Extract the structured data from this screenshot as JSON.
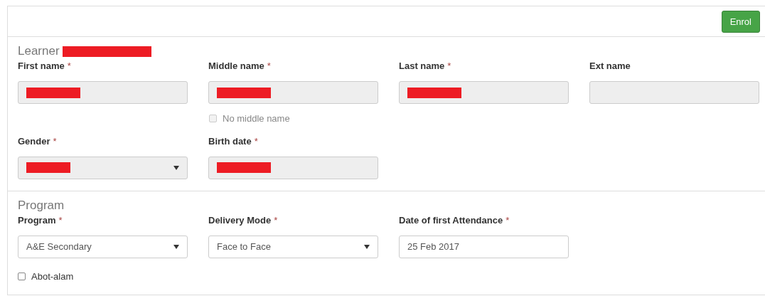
{
  "header": {
    "button": "Enrol"
  },
  "sections": [
    {
      "title": "Learner",
      "title_redacted": true,
      "rows": [
        [
          {
            "kind": "input",
            "label": "First name",
            "required_mark": "*",
            "redacted": true,
            "disabled": true
          },
          {
            "kind": "input",
            "label": "Middle name",
            "required_mark": "*",
            "redacted": true,
            "disabled": true,
            "checkbox": {
              "label": "No middle name",
              "checked": false,
              "disabled": true
            }
          },
          {
            "kind": "input",
            "label": "Last name",
            "required_mark": "*",
            "redacted": true,
            "disabled": true
          },
          {
            "kind": "input",
            "label": "Ext name",
            "disabled": true
          }
        ],
        [
          {
            "kind": "select",
            "label": "Gender",
            "required_mark": "*",
            "redacted": true,
            "disabled": true
          },
          {
            "kind": "input",
            "label": "Birth date",
            "required_mark": "*",
            "redacted": true,
            "disabled": true
          }
        ]
      ]
    },
    {
      "title": "Program",
      "rows": [
        [
          {
            "kind": "select",
            "label": "Program",
            "required_mark": "*",
            "value": "A&E Secondary",
            "disabled": false
          },
          {
            "kind": "select",
            "label": "Delivery Mode",
            "required_mark": "*",
            "value": "Face to Face",
            "disabled": false
          },
          {
            "kind": "input",
            "label": "Date of first Attendance",
            "required_mark": "*",
            "value": "25 Feb 2017",
            "disabled": false
          }
        ]
      ],
      "checkbox": {
        "label": "Abot-alam",
        "checked": false,
        "disabled": false
      }
    }
  ]
}
